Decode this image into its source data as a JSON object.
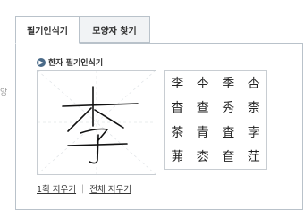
{
  "tabs": [
    {
      "label": "필기인식기",
      "active": true
    },
    {
      "label": "모양자 찾기",
      "active": false
    }
  ],
  "side_text": "앙",
  "section": {
    "icon": "arrow-bullet-icon",
    "title": "한자 필기인식기"
  },
  "canvas": {
    "drawn_character": "李"
  },
  "actions": {
    "undo_one": "1획 지우기",
    "clear_all": "전체 지우기",
    "separator": "|"
  },
  "candidates": [
    "李",
    "杢",
    "季",
    "杏",
    "杳",
    "查",
    "秀",
    "柰",
    "茶",
    "青",
    "査",
    "孛",
    "茀",
    "枩",
    "奆",
    "茳"
  ],
  "colors": {
    "border": "#b9c2ca",
    "accent": "#4a6a88"
  }
}
